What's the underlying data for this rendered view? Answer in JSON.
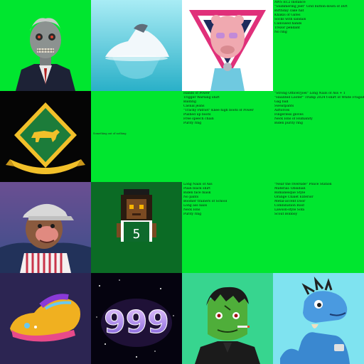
{
  "grid": {
    "tile_r1c4_lines": [
      "AWS EC2 Instance",
      "\"Shimmering Jeet\" Grid button-down of Dirt",
      "Birthday cake hat",
      "Khakis of Gates",
      "Socks with sandals",
      "Calloused hands",
      "Trezor pendant",
      "No ring"
    ],
    "tile_r2c2_text": "Something out of nothing",
    "tile_r2c3_lines": [
      "Hands of Power",
      "Trigger Warning shirt",
      "Balding",
      "Casual jeans",
      "\"Trachy Patriot\" Knee high boots of Power",
      "Pushed up boots",
      "Free speech chain",
      "Purity ring"
    ],
    "tile_r2c4_lines": [
      "\"Strong Officer/Joel\" Long Nails of Ass + 1",
      "\"Haunted Looter\" Trump 2024 t-shirt of White Fragility",
      "Gag ball",
      "Sweatpants",
      "Airforces",
      "Fingerless gloves",
      "Neck Ions of Humanity",
      "Biden purity ring"
    ],
    "tile_r3c3_lines": [
      "Long Nails of Ass",
      "Plain black shirt",
      "Biden face mask",
      "No pants",
      "Boomer trainers of School",
      "Long ass nails",
      "Neck Ions",
      "Purity ring"
    ],
    "tile_r3c4_lines": [
      "\"Near the riverside\" Police Station",
      "Material: Obsidian",
      "Romanesque Style",
      "Orange Chalet Exterior",
      "Metal-accent Door",
      "Combination Roof",
      "Lawson-style Sofa",
      "Scout Bobboy"
    ],
    "pixel_shirt_number": "5",
    "number_art": "999"
  },
  "colors": {
    "green": "#00e62f",
    "dark_green": "#0b6b25",
    "teal_bg": "#37d58f",
    "cyan_bg": "#7fe3f0"
  }
}
